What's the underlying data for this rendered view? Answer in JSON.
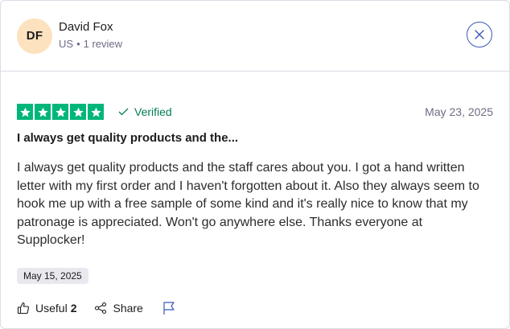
{
  "reviewer": {
    "initials": "DF",
    "name": "David Fox",
    "country": "US",
    "separator": "•",
    "review_count": "1 review"
  },
  "review": {
    "rating": 5,
    "verified_label": "Verified",
    "date_top": "May 23, 2025",
    "title": "I always get quality products and the...",
    "text": "I always get quality products and the staff cares about you. I got a hand written letter with my first order and I haven't forgotten about it. Also they always seem to hook me up with a free sample of some kind and it's really nice to know that my patronage is appreciated. Won't go anywhere else. Thanks everyone at Supplocker!",
    "experience_date": "May 15, 2025"
  },
  "actions": {
    "useful_label": "Useful",
    "useful_count": "2",
    "share_label": "Share"
  },
  "colors": {
    "star_green": "#00b67a",
    "verified_green": "#007f4e",
    "avatar_bg": "#fde2bf",
    "close_blue": "#3c57bc"
  },
  "icons": [
    "close-icon",
    "star-icon",
    "check-icon",
    "thumbs-up-icon",
    "share-icon",
    "flag-icon"
  ]
}
